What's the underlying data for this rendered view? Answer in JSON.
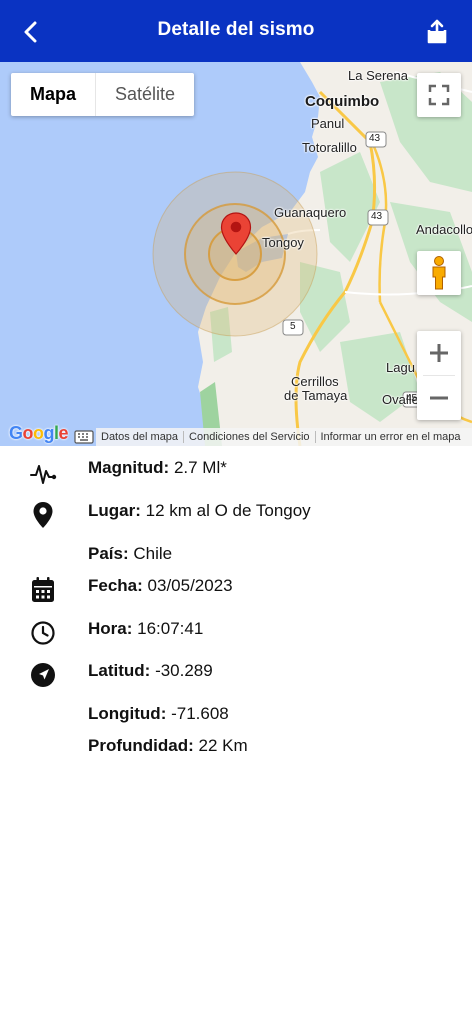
{
  "header": {
    "title": "Detalle del sismo",
    "back_icon": "back-chevron-icon",
    "share_icon": "share-icon",
    "background": "#0a33c2"
  },
  "map": {
    "toggle": {
      "map_label": "Mapa",
      "satellite_label": "Satélite",
      "selected": "Mapa"
    },
    "labels": {
      "la_serena": "La Serena",
      "coquimbo": "Coquimbo",
      "panul": "Panul",
      "totoralillo": "Totoralillo",
      "guanaquero": "Guanaquero",
      "tongoy": "Tongoy",
      "andacollo": "Andacollo",
      "cerrillos": "Cerrillos",
      "de_tamaya": "de Tamaya",
      "lagu": "Lagu",
      "ovalle": "Ovalle",
      "route_43a": "43",
      "route_43b": "43",
      "route_5": "5",
      "route_45": "45"
    },
    "google_logo": "Google",
    "footer": {
      "map_data": "Datos del mapa",
      "terms": "Condiciones del Servicio",
      "report": "Informar un error en el mapa"
    },
    "colors": {
      "water": "#aecbfa",
      "land": "#f2efe9",
      "park": "#c8e6c9",
      "road": "#f9c846",
      "pin": "#ea4335",
      "circle": "#e0b46a"
    }
  },
  "details": {
    "magnitude": {
      "label": "Magnitud:",
      "value": "2.7 Ml*"
    },
    "place": {
      "label": "Lugar:",
      "value": "12 km al O de Tongoy"
    },
    "country": {
      "label": "País:",
      "value": "Chile"
    },
    "date": {
      "label": "Fecha:",
      "value": "03/05/2023"
    },
    "time": {
      "label": "Hora:",
      "value": "16:07:41"
    },
    "latitude": {
      "label": "Latitud:",
      "value": "-30.289"
    },
    "longitude": {
      "label": "Longitud:",
      "value": "-71.608"
    },
    "depth": {
      "label": "Profundidad:",
      "value": "22 Km"
    }
  }
}
